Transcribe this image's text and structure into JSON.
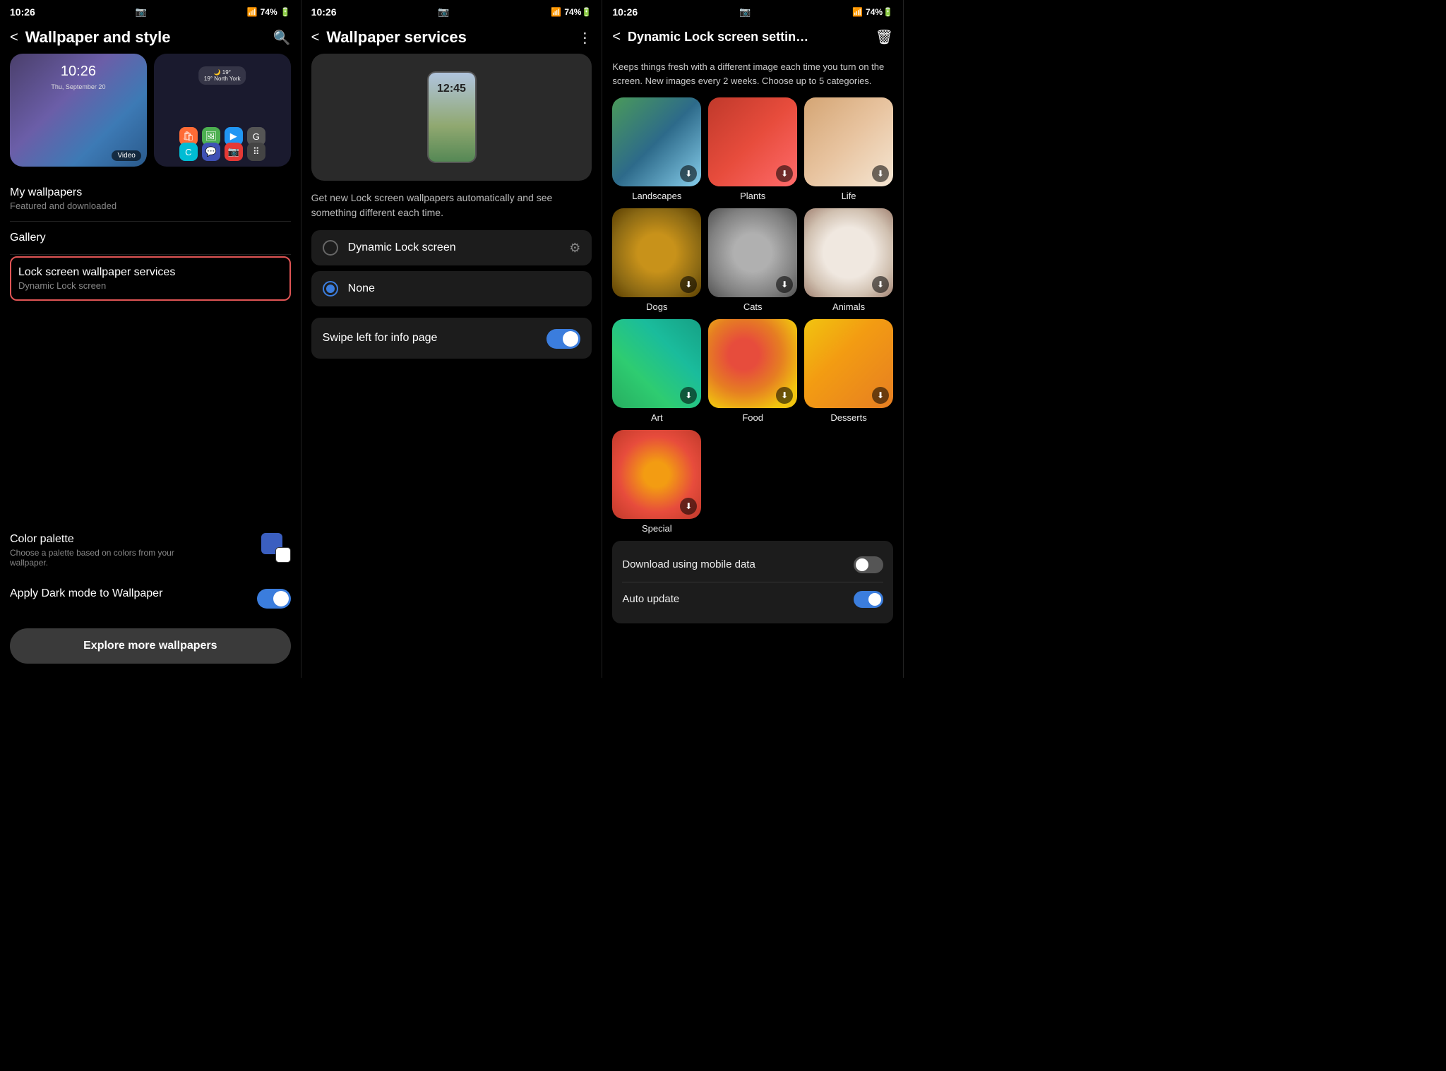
{
  "panel1": {
    "status": {
      "time": "10:26",
      "signal": "WiFi",
      "bars": "▲▲▲",
      "battery": "74%"
    },
    "title": "Wallpaper and style",
    "back": "<",
    "search_icon": "🔍",
    "preview_time": "10:26",
    "preview_date": "Thu, September 20",
    "weather": "19° North York",
    "video_badge": "Video",
    "menu_items": [
      {
        "title": "My wallpapers",
        "sub": "Featured and downloaded"
      },
      {
        "title": "Gallery",
        "sub": ""
      },
      {
        "title": "Lock screen wallpaper services",
        "sub": "Dynamic Lock screen",
        "highlighted": true
      }
    ],
    "color_palette_title": "Color palette",
    "color_palette_sub": "Choose a palette based on colors from your wallpaper.",
    "dark_mode_title": "Apply Dark mode to Wallpaper",
    "explore_btn": "Explore more wallpapers"
  },
  "panel2": {
    "status": {
      "time": "10:26"
    },
    "title": "Wallpaper services",
    "more_icon": "⋮",
    "mockup_time": "12:45",
    "description": "Get new Lock screen wallpapers automatically and see something different each time.",
    "options": [
      {
        "label": "Dynamic Lock screen",
        "selected": false,
        "gear": true
      },
      {
        "label": "None",
        "selected": true,
        "gear": false
      }
    ],
    "swipe_label": "Swipe left for info page",
    "swipe_on": true
  },
  "panel3": {
    "status": {
      "time": "10:26"
    },
    "title": "Dynamic Lock screen settin…",
    "description": "Keeps things fresh with a different image each time you turn on the screen. New images every 2 weeks. Choose up to 5 categories.",
    "categories": [
      {
        "name": "Landscapes",
        "class": "cat-landscapes"
      },
      {
        "name": "Plants",
        "class": "cat-plants"
      },
      {
        "name": "Life",
        "class": "cat-life"
      },
      {
        "name": "Dogs",
        "class": "cat-dogs-img"
      },
      {
        "name": "Cats",
        "class": "cat-cats-img"
      },
      {
        "name": "Animals",
        "class": "cat-animals-img"
      },
      {
        "name": "Art",
        "class": "cat-art-img"
      },
      {
        "name": "Food",
        "class": "cat-food-img"
      },
      {
        "name": "Desserts",
        "class": "cat-desserts-img"
      },
      {
        "name": "Special",
        "class": "cat-special-img"
      }
    ],
    "download_mobile_label": "Download using mobile data",
    "auto_update_label": "Auto update",
    "download_mobile_on": false,
    "auto_update_on": true
  }
}
